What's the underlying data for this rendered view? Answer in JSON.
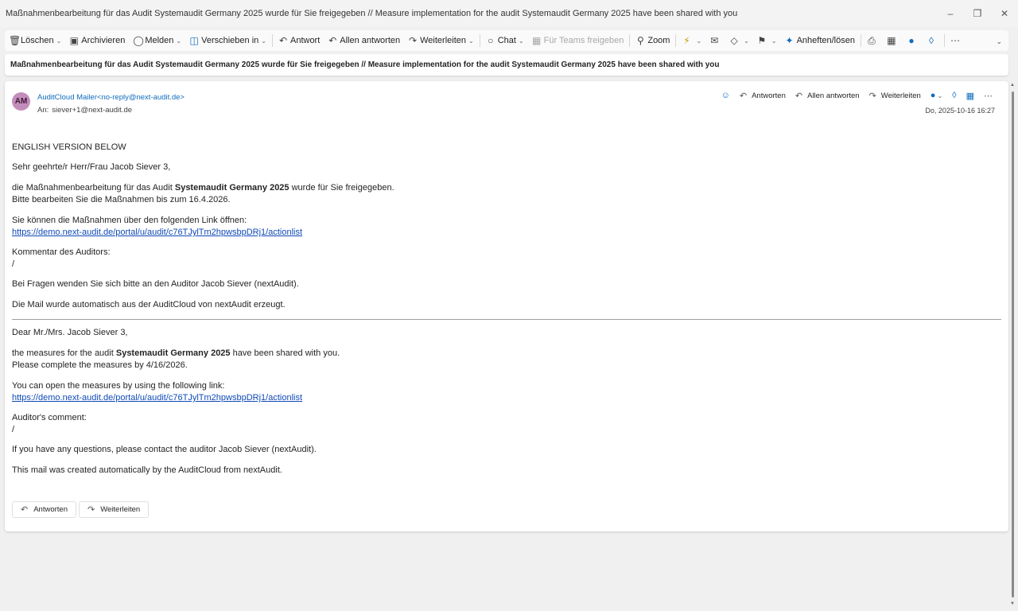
{
  "window": {
    "title": "Maßnahmenbearbeitung für das Audit Systemaudit Germany 2025 wurde für Sie freigegeben // Measure implementation for the audit Systemaudit Germany 2025 have been shared with you"
  },
  "toolbar": {
    "delete": "Löschen",
    "archive": "Archivieren",
    "report": "Melden",
    "move": "Verschieben in",
    "reply": "Antwort",
    "reply_all": "Allen antworten",
    "forward": "Weiterleiten",
    "chat": "Chat",
    "teams": "Für Teams freigeben",
    "zoom": "Zoom",
    "pin": "Anheften/lösen"
  },
  "subject": "Maßnahmenbearbeitung für das Audit Systemaudit Germany 2025 wurde für Sie freigegeben // Measure implementation for the audit Systemaudit Germany 2025 have been shared with you",
  "message": {
    "avatar_initials": "AM",
    "sender": "AuditCloud Mailer<no-reply@next-audit.de>",
    "to_label": "An:",
    "to": "siever+1@next-audit.de",
    "date": "Do, 2025-10-16 16:27",
    "actions": {
      "reply": "Antworten",
      "reply_all": "Allen antworten",
      "forward": "Weiterleiten"
    }
  },
  "body": {
    "de": {
      "intro": "ENGLISH VERSION BELOW",
      "greeting": "Sehr geehrte/r Herr/Frau Jacob Siever 3,",
      "line1_pre": "die Maßnahmenbearbeitung für das Audit ",
      "line1_bold": "Systemaudit Germany 2025",
      "line1_post": " wurde für Sie freigegeben.",
      "line2": "Bitte bearbeiten Sie die Maßnahmen bis zum 16.4.2026.",
      "link_intro": "Sie können die Maßnahmen über den folgenden Link öffnen:",
      "link": "https://demo.next-audit.de/portal/u/audit/c76TJylTm2hpwsbpDRj1/actionlist",
      "comment_label": "Kommentar des Auditors:",
      "comment": "/",
      "questions": "Bei Fragen wenden Sie sich bitte an den Auditor Jacob Siever (nextAudit).",
      "auto": "Die Mail wurde automatisch aus der AuditCloud von nextAudit erzeugt."
    },
    "en": {
      "greeting": "Dear Mr./Mrs. Jacob Siever 3,",
      "line1_pre": "the measures for the audit ",
      "line1_bold": "Systemaudit Germany 2025",
      "line1_post": " have been shared with you.",
      "line2": "Please complete the measures by 4/16/2026.",
      "link_intro": "You can open the measures by using the following link:",
      "link": "https://demo.next-audit.de/portal/u/audit/c76TJylTm2hpwsbpDRj1/actionlist",
      "comment_label": "Auditor's comment:",
      "comment": "/",
      "questions": "If you have any questions, please contact the auditor Jacob Siever (nextAudit).",
      "auto": "This mail was created automatically by the AuditCloud from nextAudit."
    }
  },
  "footer_buttons": {
    "reply": "Antworten",
    "forward": "Weiterleiten"
  },
  "colors": {
    "accent": "#0f6cbd",
    "avatar": "#c38dbb",
    "link": "#0f4ab8"
  }
}
